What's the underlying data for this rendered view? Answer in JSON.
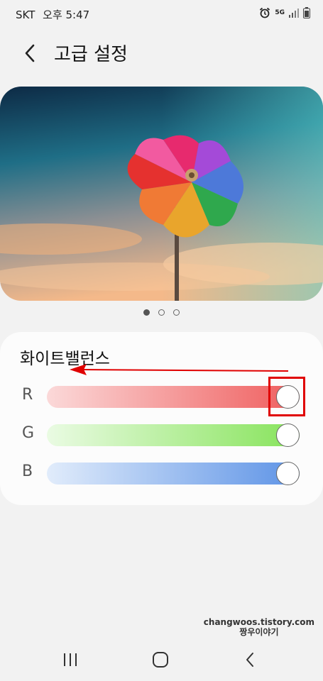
{
  "status": {
    "carrier": "SKT",
    "time": "오후 5:47",
    "network": "5G"
  },
  "header": {
    "title": "고급 설정"
  },
  "pager": {
    "total": 3,
    "active": 0
  },
  "white_balance": {
    "title": "화이트밸런스",
    "sliders": [
      {
        "label": "R",
        "value": 1.0,
        "color_start": "#fbd9d9",
        "color_end": "#ef5d5d"
      },
      {
        "label": "G",
        "value": 1.0,
        "color_start": "#eafbe3",
        "color_end": "#86e35a"
      },
      {
        "label": "B",
        "value": 1.0,
        "color_start": "#e1ecfb",
        "color_end": "#5d93e6"
      }
    ]
  },
  "watermark": {
    "line1": "changwoos.tistory.com",
    "line2": "짱우이야기"
  },
  "colors": {
    "annotation": "#e00000"
  }
}
